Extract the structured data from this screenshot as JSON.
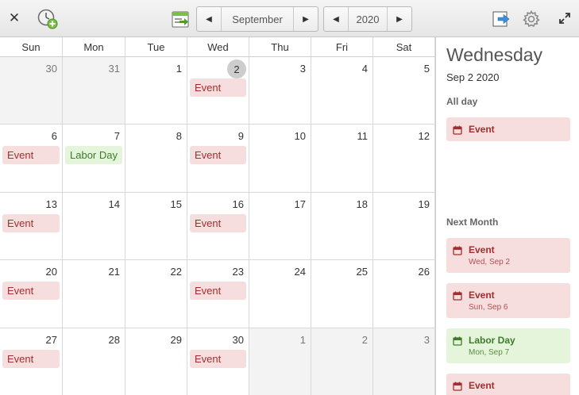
{
  "header": {
    "close_icon": "close-icon",
    "add_event_icon": "add-event-icon",
    "today_icon": "go-to-today-icon",
    "export_icon": "export-icon",
    "settings_icon": "gear-icon",
    "fullscreen_icon": "fullscreen-icon",
    "month": "September",
    "year": "2020"
  },
  "weekdays": [
    "Sun",
    "Mon",
    "Tue",
    "Wed",
    "Thu",
    "Fri",
    "Sat"
  ],
  "weeks": [
    [
      {
        "n": "30",
        "other": true
      },
      {
        "n": "31",
        "other": true
      },
      {
        "n": "1"
      },
      {
        "n": "2",
        "today": true,
        "event": "Event",
        "color": "red"
      },
      {
        "n": "3"
      },
      {
        "n": "4"
      },
      {
        "n": "5"
      }
    ],
    [
      {
        "n": "6",
        "event": "Event",
        "color": "red"
      },
      {
        "n": "7",
        "event": "Labor Day",
        "color": "green"
      },
      {
        "n": "8"
      },
      {
        "n": "9",
        "event": "Event",
        "color": "red"
      },
      {
        "n": "10"
      },
      {
        "n": "11"
      },
      {
        "n": "12"
      }
    ],
    [
      {
        "n": "13",
        "event": "Event",
        "color": "red"
      },
      {
        "n": "14"
      },
      {
        "n": "15"
      },
      {
        "n": "16",
        "event": "Event",
        "color": "red"
      },
      {
        "n": "17"
      },
      {
        "n": "18"
      },
      {
        "n": "19"
      }
    ],
    [
      {
        "n": "20",
        "event": "Event",
        "color": "red"
      },
      {
        "n": "21"
      },
      {
        "n": "22"
      },
      {
        "n": "23",
        "event": "Event",
        "color": "red"
      },
      {
        "n": "24"
      },
      {
        "n": "25"
      },
      {
        "n": "26"
      }
    ],
    [
      {
        "n": "27",
        "event": "Event",
        "color": "red"
      },
      {
        "n": "28"
      },
      {
        "n": "29"
      },
      {
        "n": "30",
        "event": "Event",
        "color": "red"
      },
      {
        "n": "1",
        "other": true
      },
      {
        "n": "2",
        "other": true
      },
      {
        "n": "3",
        "other": true
      }
    ]
  ],
  "sidebar": {
    "day_name": "Wednesday",
    "date": "Sep  2 2020",
    "all_day_label": "All day",
    "all_day_events": [
      {
        "title": "Event",
        "color": "red"
      }
    ],
    "next_month_label": "Next Month",
    "upcoming": [
      {
        "title": "Event",
        "sub": "Wed, Sep 2",
        "color": "red"
      },
      {
        "title": "Event",
        "sub": "Sun, Sep 6",
        "color": "red"
      },
      {
        "title": "Labor Day",
        "sub": "Mon, Sep 7",
        "color": "green"
      },
      {
        "title": "Event",
        "sub": "",
        "color": "red"
      }
    ]
  },
  "colors": {
    "event_red_bg": "#f7dede",
    "event_red_text": "#a12f2f",
    "event_green_bg": "#e5f5dc",
    "event_green_text": "#3e7a2a",
    "today_circle": "#cdcdcd"
  }
}
